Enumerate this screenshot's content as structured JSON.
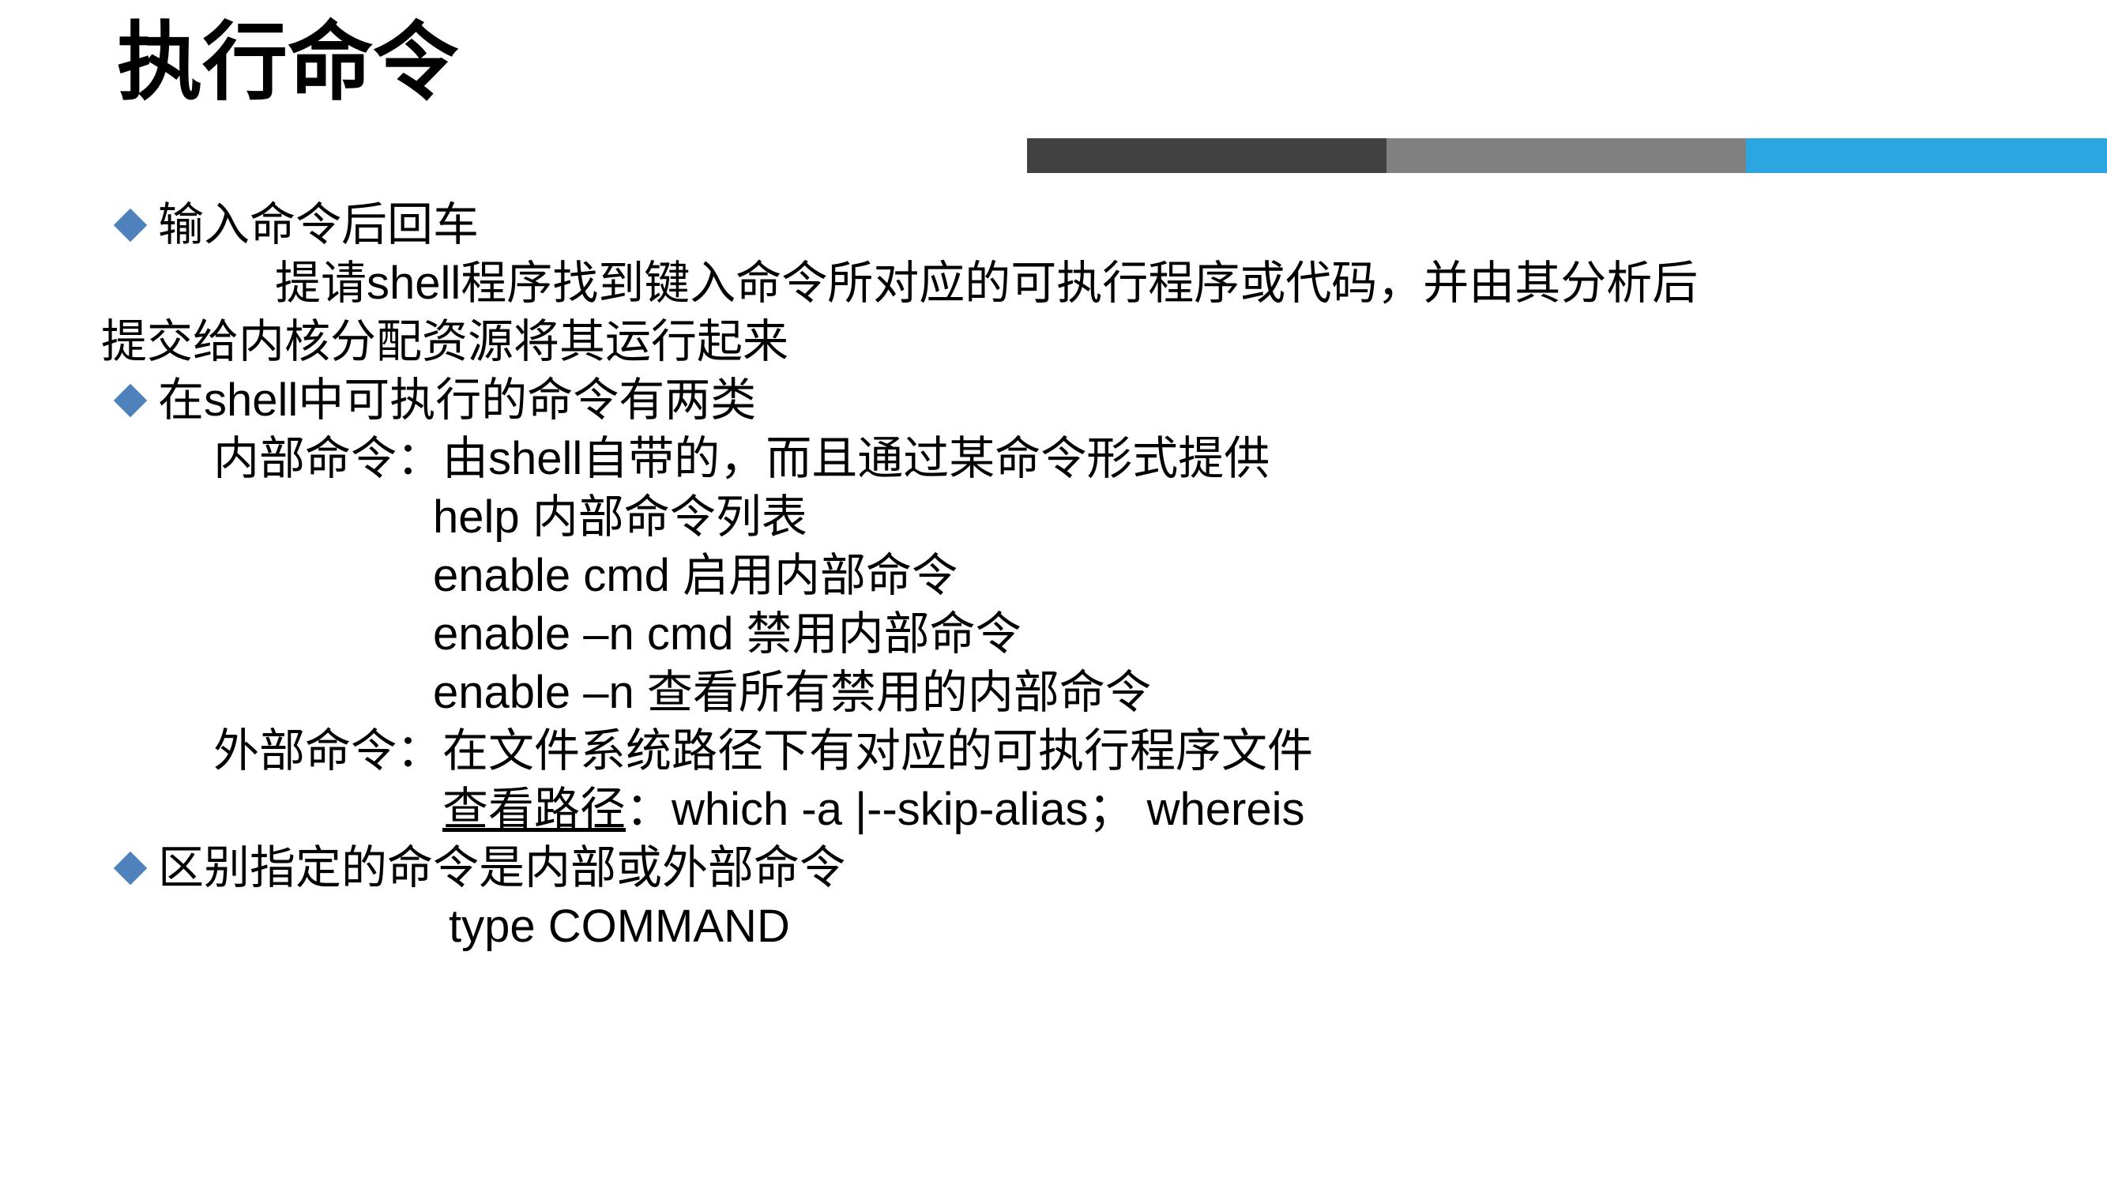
{
  "slide": {
    "title": "执行命令",
    "accent_bar": {
      "segments": [
        {
          "name": "dark",
          "color": "#414141"
        },
        {
          "name": "gray",
          "color": "#808080"
        },
        {
          "name": "blue",
          "color": "#2BA6E0"
        }
      ]
    },
    "bullet_marker_color": "#4F81BD",
    "content": {
      "bullet1": "输入命令后回车",
      "para1_line1": "提请shell程序找到键入命令所对应的可执行程序或代码，并由其分析后",
      "para1_line2": "提交给内核分配资源将其运行起来",
      "bullet2": "在shell中可执行的命令有两类",
      "internal_heading": "内部命令：由shell自带的，而且通过某命令形式提供",
      "cmd_help": "help 内部命令列表",
      "cmd_enable": "enable cmd 启用内部命令",
      "cmd_enable_n_cmd": "enable –n cmd 禁用内部命令",
      "cmd_enable_n": "enable –n 查看所有禁用的内部命令",
      "external_heading": "外部命令：在文件系统路径下有对应的可执行程序文件",
      "path_label": "查看路径",
      "path_rest": "：which  -a |--skip-alias；  whereis",
      "bullet3": "区别指定的命令是内部或外部命令",
      "cmd_type": "type COMMAND"
    }
  }
}
